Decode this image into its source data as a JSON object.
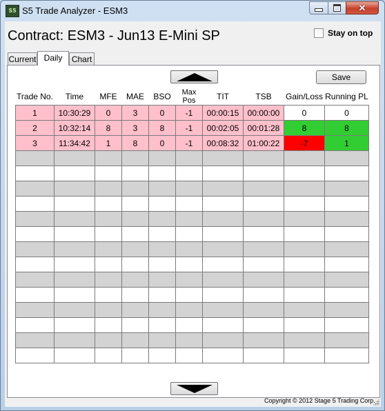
{
  "window": {
    "title": "S5 Trade Analyzer - ESM3",
    "icon": "s5-app-icon",
    "icon_text": "S5"
  },
  "header": {
    "contract_label": "Contract: ESM3 - Jun13 E-Mini SP",
    "stay_on_top_label": "Stay on top",
    "stay_on_top_checked": false
  },
  "tabs": [
    {
      "label": "Current"
    },
    {
      "label": "Daily",
      "active": true
    },
    {
      "label": "Chart"
    }
  ],
  "toolbar": {
    "save_label": "Save",
    "scroll_up_icon": "triangle-up-icon",
    "scroll_down_icon": "triangle-down-icon"
  },
  "table": {
    "columns": [
      "Trade No.",
      "Time",
      "MFE",
      "MAE",
      "BSO",
      "Max Pos",
      "TIT",
      "TSB",
      "Gain/Loss",
      "Running PL"
    ],
    "rows": [
      {
        "trade_no": "1",
        "time": "10:30:29",
        "mfe": "0",
        "mae": "3",
        "bso": "0",
        "max_pos": "-1",
        "tit": "00:00:15",
        "tsb": "00:00:00",
        "gain_loss": "0",
        "running_pl": "0",
        "gain_loss_status": "neutral",
        "running_pl_status": "neutral"
      },
      {
        "trade_no": "2",
        "time": "10:32:14",
        "mfe": "8",
        "mae": "3",
        "bso": "8",
        "max_pos": "-1",
        "tit": "00:02:05",
        "tsb": "00:01:28",
        "gain_loss": "8",
        "running_pl": "8",
        "gain_loss_status": "pos",
        "running_pl_status": "pos"
      },
      {
        "trade_no": "3",
        "time": "11:34:42",
        "mfe": "1",
        "mae": "8",
        "bso": "0",
        "max_pos": "-1",
        "tit": "00:08:32",
        "tsb": "01:00:22",
        "gain_loss": "-7",
        "running_pl": "1",
        "gain_loss_status": "neg",
        "running_pl_status": "pos"
      }
    ],
    "empty_row_count": 14
  },
  "colors": {
    "trade_row": "#ffc0cb",
    "gain": "#32cd32",
    "loss": "#ff0000",
    "stripe": "#d3d3d3"
  },
  "footer": {
    "copyright": "Copyright © 2012 Stage 5 Trading Corp."
  }
}
